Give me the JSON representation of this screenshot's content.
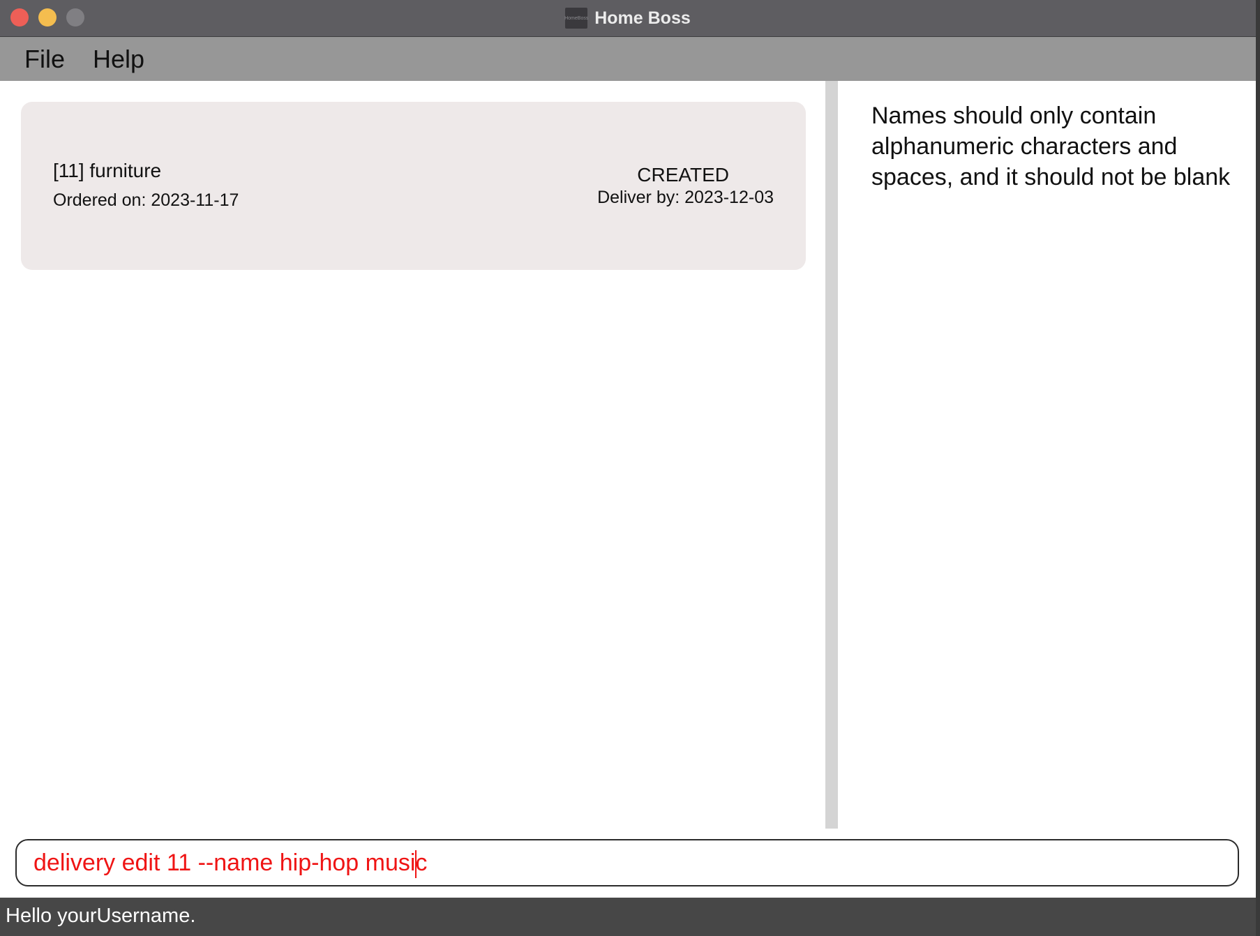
{
  "window": {
    "title": "Home Boss",
    "app_icon_label": "HomeBoss"
  },
  "menu": {
    "items": [
      {
        "label": "File"
      },
      {
        "label": "Help"
      }
    ]
  },
  "delivery_list": {
    "items": [
      {
        "name": "[11] furniture",
        "ordered": "Ordered on: 2023-11-17",
        "status": "CREATED",
        "deliver_by": "Deliver by: 2023-12-03"
      }
    ]
  },
  "result": {
    "message": "Names should only contain alphanumeric characters and spaces, and it should not be blank"
  },
  "command": {
    "value": "delivery edit 11 --name hip-hop music",
    "text_color": "#ef1414"
  },
  "status_bar": {
    "text": "Hello yourUsername."
  },
  "colors": {
    "titlebar": "#5e5d61",
    "menubar": "#979797",
    "card_bg": "#eee9e9",
    "divider": "#d4d4d4",
    "statusbar": "#474747",
    "close": "#ee5f57",
    "minimize": "#f4bd4f",
    "maximize": "#807f83"
  }
}
